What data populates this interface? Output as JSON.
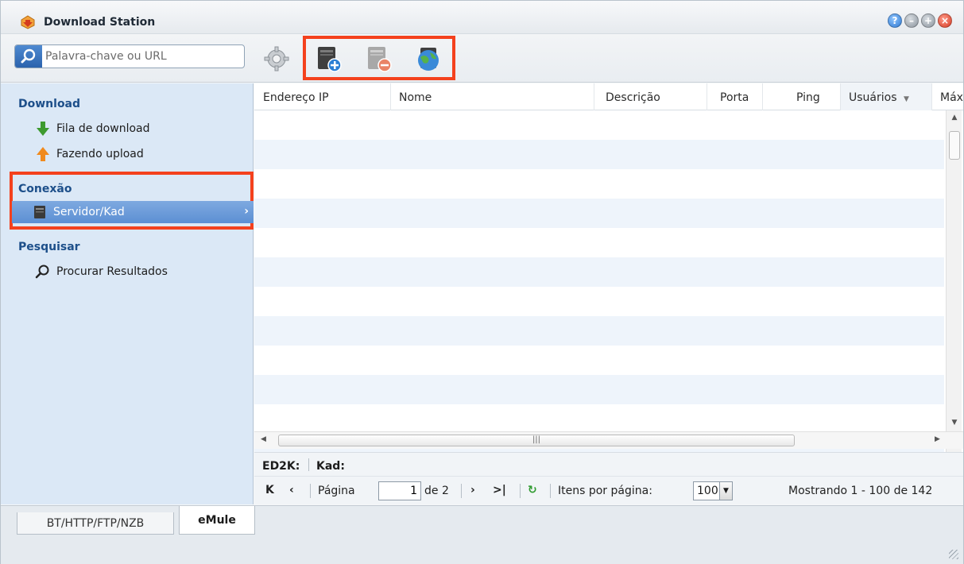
{
  "window": {
    "title": "Download Station"
  },
  "toolbar": {
    "search_placeholder": "Palavra-chave ou URL",
    "buttons": [
      "settings-gear-icon",
      "add-server-icon",
      "remove-server-icon",
      "connect-globe-icon"
    ]
  },
  "sidebar": {
    "download_header": "Download",
    "download_items": [
      {
        "label": "Fila de download",
        "icon": "arrow-down-green-icon"
      },
      {
        "label": "Fazendo upload",
        "icon": "arrow-up-orange-icon"
      }
    ],
    "connection_header": "Conexão",
    "connection_items": [
      {
        "label": "Servidor/Kad",
        "icon": "server-icon",
        "active": true
      }
    ],
    "search_header": "Pesquisar",
    "search_items": [
      {
        "label": "Procurar Resultados",
        "icon": "magnifier-icon"
      }
    ]
  },
  "grid": {
    "columns": [
      "Endereço IP",
      "Nome",
      "Descrição",
      "Porta",
      "Ping",
      "Usuários",
      "Máx"
    ],
    "sorted_column": "Usuários"
  },
  "status": {
    "ed2k": "ED2K:",
    "kad": "Kad:"
  },
  "pager": {
    "page_label": "Página",
    "page_value": "1",
    "of_label": "de 2",
    "per_page_label": "Itens por página:",
    "per_page_value": "100",
    "summary": "Mostrando 1 - 100 de 142"
  },
  "tabs": {
    "tab1": "BT/HTTP/FTP/NZB",
    "tab2": "eMule"
  },
  "colors": {
    "highlight": "#f4411d",
    "sidebar_bg": "#dbe8f6",
    "section_header": "#1d4f8a",
    "active_item": "#6a9ad8"
  }
}
